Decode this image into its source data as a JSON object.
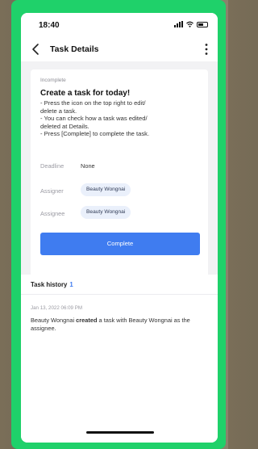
{
  "status_bar": {
    "time": "18:40"
  },
  "nav": {
    "title": "Task Details",
    "back_icon": "chevron-left-icon",
    "more_icon": "more-vertical-icon"
  },
  "task": {
    "status": "Incomplete",
    "title": "Create a task for today!",
    "description_lines": [
      "- Press the icon on the top right to edit/",
      "delete a task.",
      "- You can check how a task was edited/",
      "deleted at Details.",
      "- Press [Complete] to complete the task."
    ],
    "deadline_label": "Deadline",
    "deadline_value": "None",
    "assigner_label": "Assigner",
    "assigner_value": "Beauty Wongnai",
    "assignee_label": "Assignee",
    "assignee_value": "Beauty Wongnai",
    "complete_label": "Complete"
  },
  "history": {
    "title": "Task history",
    "count": "1",
    "entries": [
      {
        "time": "Jan 13, 2022 06:09 PM",
        "actor": "Beauty Wongnai",
        "action": "created",
        "rest": "a task with Beauty Wongnai as the assignee."
      }
    ]
  },
  "colors": {
    "frame": "#1fd16a",
    "accent": "#3f7cf0",
    "chip_bg": "#eaf0fb"
  }
}
